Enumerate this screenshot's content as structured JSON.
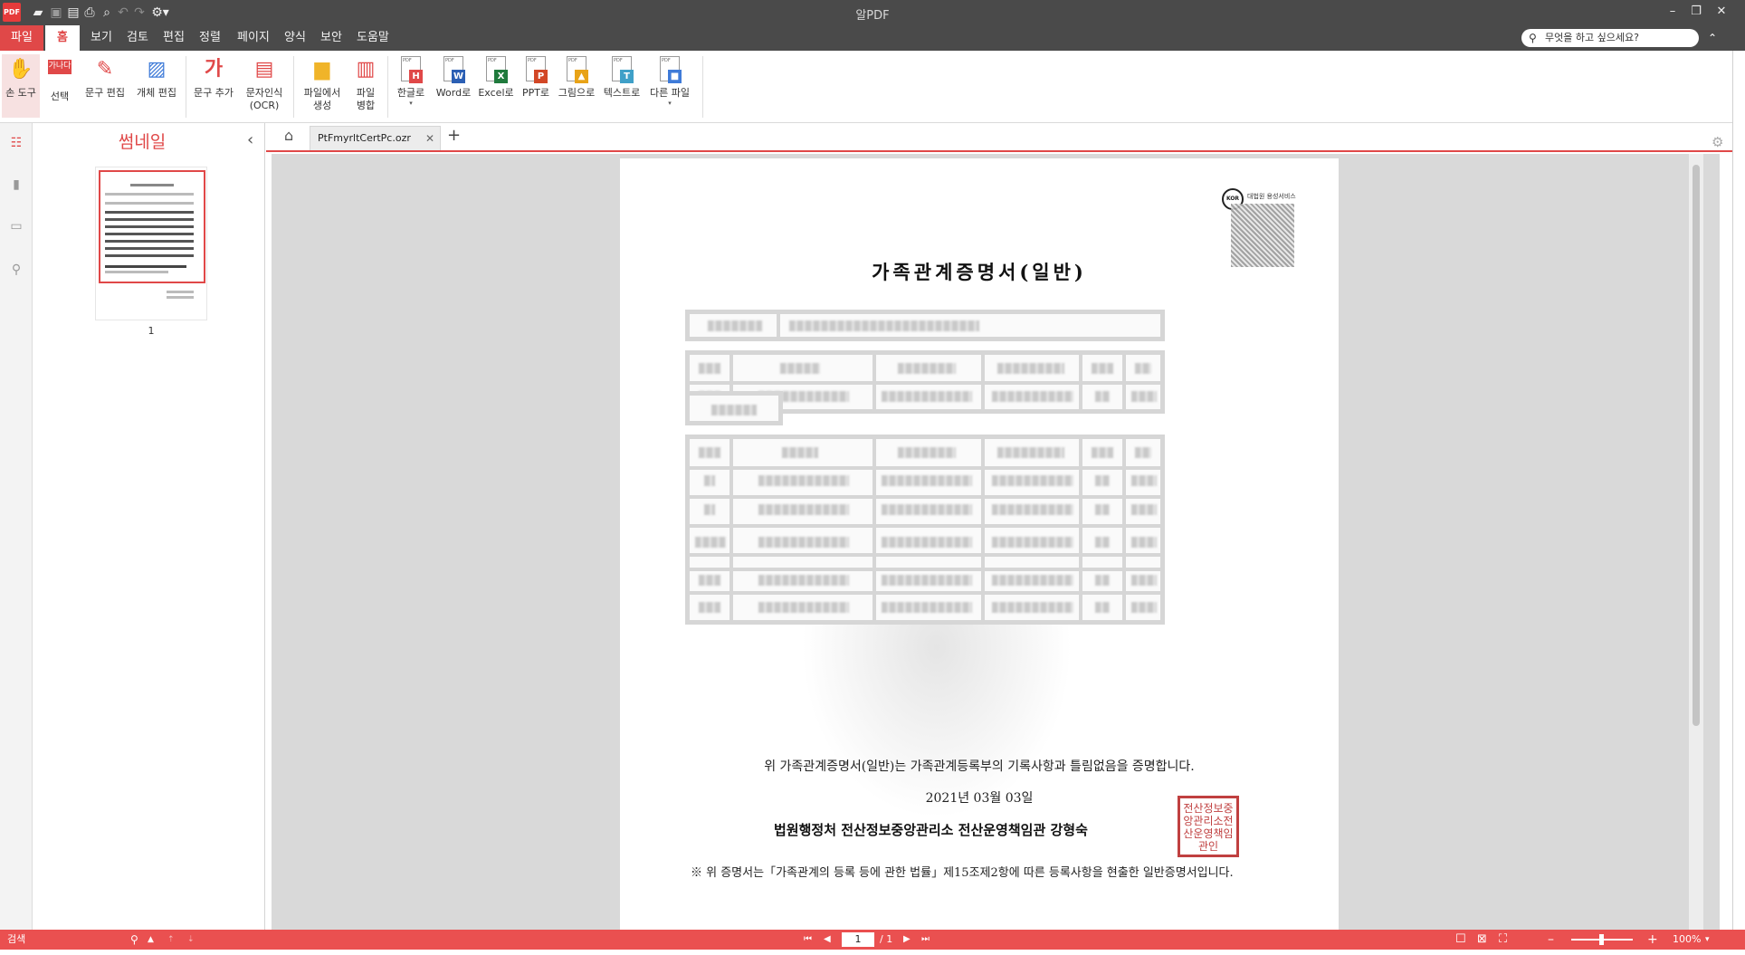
{
  "window": {
    "title": "알PDF",
    "logo_text": "PDF"
  },
  "quick_access": [
    {
      "name": "open-folder-icon"
    },
    {
      "name": "save-icon"
    },
    {
      "name": "save-as-icon"
    },
    {
      "name": "print-icon"
    },
    {
      "name": "print-preview-icon"
    },
    {
      "name": "undo-icon"
    },
    {
      "name": "redo-icon"
    },
    {
      "name": "customize-icon"
    }
  ],
  "menu": {
    "items": [
      "파일",
      "홈",
      "보기",
      "검토",
      "편집",
      "정렬",
      "페이지",
      "양식",
      "보안",
      "도움말"
    ],
    "active": "홈",
    "search_placeholder": "무엇을 하고 싶으세요?"
  },
  "ribbon": {
    "buttons": [
      {
        "label": "손 도구",
        "icon": "hand-icon"
      },
      {
        "label": "선택",
        "icon": "select-text-icon",
        "icon_text": "가나다"
      },
      {
        "label": "문구 편집",
        "icon": "edit-text-icon"
      },
      {
        "label": "개체 편집",
        "icon": "edit-object-icon"
      },
      {
        "label": "문구 추가",
        "icon": "add-text-icon",
        "icon_text": "가"
      },
      {
        "label": "문자인식",
        "label2": "(OCR)",
        "icon": "ocr-icon"
      },
      {
        "label": "파일에서",
        "label2": "생성",
        "icon": "folder-icon"
      },
      {
        "label": "파일",
        "label2": "병합",
        "icon": "merge-icon"
      },
      {
        "label": "한글로",
        "icon": "hwp-icon",
        "tag": "H",
        "color": "#e04848"
      },
      {
        "label": "Word로",
        "icon": "word-icon",
        "tag": "W",
        "color": "#2b5fb4"
      },
      {
        "label": "Excel로",
        "icon": "excel-icon",
        "tag": "X",
        "color": "#1f7a3c"
      },
      {
        "label": "PPT로",
        "icon": "ppt-icon",
        "tag": "P",
        "color": "#d24726"
      },
      {
        "label": "그림으로",
        "icon": "image-icon",
        "tag": "▲",
        "color": "#e8a317"
      },
      {
        "label": "텍스트로",
        "icon": "text-file-icon",
        "tag": "T",
        "color": "#3fa0c8"
      },
      {
        "label": "다른 파일",
        "icon": "other-file-icon",
        "tag": "■",
        "color": "#3f7bd8"
      }
    ],
    "active_button": "손 도구"
  },
  "sidebar": {
    "panel_title": "썸네일",
    "thumbnail_page": "1",
    "icons": [
      "thumbnail-list-icon",
      "bookmark-icon",
      "comment-icon",
      "search-icon"
    ]
  },
  "tabs": {
    "open_file": "PtFmyrltCertPc.ozr"
  },
  "document": {
    "qr_label": "대법원 용성서비스",
    "qr_logo": "KOR",
    "title": "가족관계증명서(일반)",
    "certify_line": "위 가족관계증명서(일반)는 가족관계등록부의 기록사항과 틀림없음을 증명합니다.",
    "date": "2021년 03월 03일",
    "issuer": "법원행정처 전산정보중앙관리소 전산운영책임관 강형숙",
    "seal_text": "전산정보중앙관리소전산운영책임관인",
    "note": "※ 위 증명서는「가족관계의 등록 등에 관한 법률」제15조제2항에 따른 등록사항을 현출한 일반증명서입니다."
  },
  "statusbar": {
    "left_label": "검색",
    "page_current": "1",
    "page_total": "/ 1",
    "zoom": "100%"
  }
}
